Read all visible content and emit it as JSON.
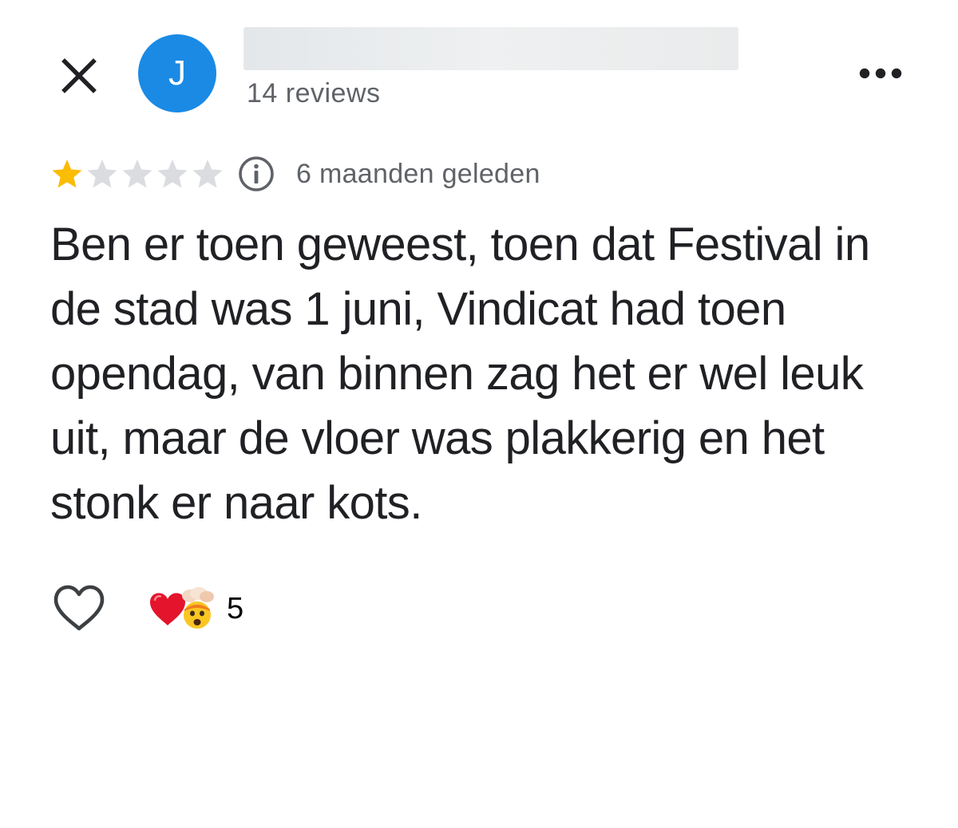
{
  "header": {
    "close_icon": "close-icon",
    "avatar_letter": "J",
    "reviewer_name": "",
    "review_count": "14 reviews",
    "more_icon": "more-horizontal-icon"
  },
  "review": {
    "rating": 1,
    "max_rating": 5,
    "time_ago": "6 maanden geleden",
    "info_icon": "info-icon",
    "text": "Ben er toen geweest, toen dat Festival in de stad was 1 juni, Vindicat had toen opendag, van binnen zag het er wel leuk uit, maar de vloer was plakkerig en het stonk er naar kots."
  },
  "actions": {
    "like_icon": "heart-outline-icon",
    "reaction_icons": [
      "red-heart-emoji",
      "exploding-head-emoji"
    ],
    "reaction_count": "5"
  },
  "colors": {
    "avatar": "#1a8ae5",
    "star_filled": "#fbbc04",
    "star_empty": "#dadce0",
    "secondary_text": "#5f6368",
    "primary_text": "#202124"
  }
}
